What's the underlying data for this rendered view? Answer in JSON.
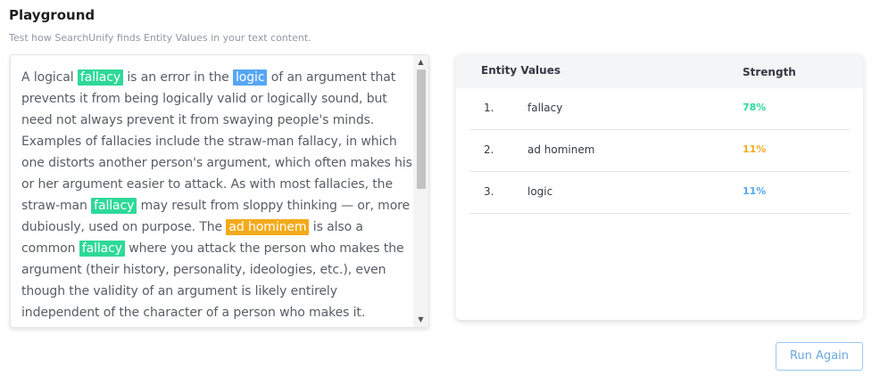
{
  "header": {
    "title": "Playground",
    "subtitle": "Test how SearchUnify finds Entity Values in your text content."
  },
  "text_content": {
    "segments": [
      {
        "text": "A logical ",
        "highlight": null
      },
      {
        "text": "fallacy",
        "highlight": "green"
      },
      {
        "text": " is an error in the ",
        "highlight": null
      },
      {
        "text": "logic",
        "highlight": "blue"
      },
      {
        "text": " of an argument that prevents it from being logically valid or logically sound, but need not always prevent it from swaying people's minds. Examples of fallacies include the straw-man fallacy, in which one distorts another person's argument, which often makes his or her argument easier to attack. As with most fallacies, the straw-man ",
        "highlight": null
      },
      {
        "text": "fallacy",
        "highlight": "green"
      },
      {
        "text": " may result from sloppy thinking — or, more dubiously, used on purpose. The ",
        "highlight": null
      },
      {
        "text": "ad hominem",
        "highlight": "orange"
      },
      {
        "text": " is also a common ",
        "highlight": null
      },
      {
        "text": "fallacy",
        "highlight": "green"
      },
      {
        "text": " where you attack the person who makes the argument (their history, personality, ideologies, etc.), even though the validity of an argument is likely entirely independent of the character of a person who makes it.",
        "highlight": null
      }
    ]
  },
  "scrollbar": {
    "up_arrow": "▲",
    "down_arrow": "▼"
  },
  "entity_table": {
    "columns": {
      "entity": "Entity Values",
      "strength": "Strength"
    },
    "rows": [
      {
        "index": "1.",
        "name": "fallacy",
        "strength": "78%",
        "color": "#2ed998"
      },
      {
        "index": "2.",
        "name": "ad hominem",
        "strength": "11%",
        "color": "#f3aa1c"
      },
      {
        "index": "3.",
        "name": "logic",
        "strength": "11%",
        "color": "#56a6f4"
      }
    ]
  },
  "actions": {
    "run_again_label": "Run Again"
  },
  "colors": {
    "green_highlight": "#2ed998",
    "blue_highlight": "#56a6f4",
    "orange_highlight": "#f3aa1c",
    "button_border": "#9cc9ef"
  }
}
